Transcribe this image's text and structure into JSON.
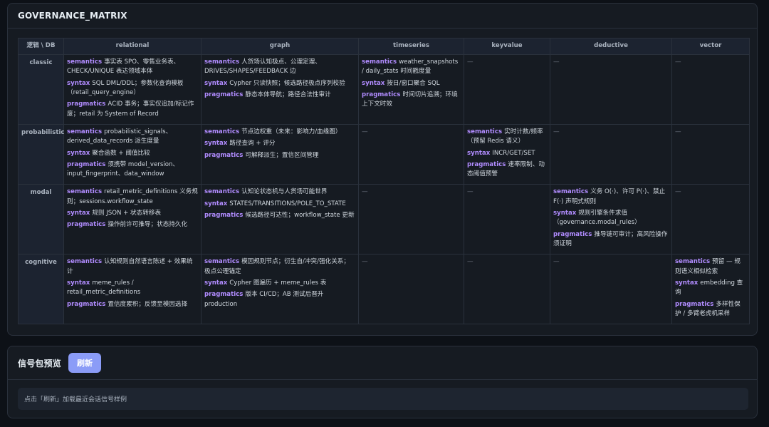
{
  "matrix": {
    "title": "GOVERNANCE_MATRIX",
    "corner_header": "逻辑 \\ DB",
    "columns": [
      "relational",
      "graph",
      "timeseries",
      "keyvalue",
      "deductive",
      "vector"
    ],
    "rows": [
      {
        "label": "classic",
        "cells": [
          [
            {
              "k": "semantics",
              "t": "事实表 SPO、零售业务表、CHECK/UNIQUE 表达领域本体"
            },
            {
              "k": "syntax",
              "t": "SQL DML/DDL；参数化查询模板（retail_query_engine）"
            },
            {
              "k": "pragmatics",
              "t": "ACID 事务；事实仅追加/标记作废；retail 为 System of Record"
            }
          ],
          [
            {
              "k": "semantics",
              "t": "人货场认知极点、公理定理、DRIVES/SHAPES/FEEDBACK 边"
            },
            {
              "k": "syntax",
              "t": "Cypher 只读快照；候选路径极点序列校验"
            },
            {
              "k": "pragmatics",
              "t": "静态本体导航；路径合法性审计"
            }
          ],
          [
            {
              "k": "semantics",
              "t": "weather_snapshots / daily_stats 时间戳度量"
            },
            {
              "k": "syntax",
              "t": "按日/窗口聚合 SQL"
            },
            {
              "k": "pragmatics",
              "t": "时间切片追溯；环境上下文时效"
            }
          ],
          "—",
          "—",
          "—"
        ]
      },
      {
        "label": "probabilistic",
        "cells": [
          [
            {
              "k": "semantics",
              "t": "probabilistic_signals、derived_data_records 派生度量"
            },
            {
              "k": "syntax",
              "t": "聚合函数 + 阈值比较"
            },
            {
              "k": "pragmatics",
              "t": "须携带 model_version、input_fingerprint、data_window"
            }
          ],
          [
            {
              "k": "semantics",
              "t": "节点边权重（未来：影响力/血缘图）"
            },
            {
              "k": "syntax",
              "t": "路径查询 + 评分"
            },
            {
              "k": "pragmatics",
              "t": "可解释派生；置信区间管理"
            }
          ],
          "—",
          [
            {
              "k": "semantics",
              "t": "实时计数/频率（预留 Redis 语义）"
            },
            {
              "k": "syntax",
              "t": "INCR/GET/SET"
            },
            {
              "k": "pragmatics",
              "t": "速率限制、动态阈值预警"
            }
          ],
          "—",
          "—"
        ]
      },
      {
        "label": "modal",
        "cells": [
          [
            {
              "k": "semantics",
              "t": "retail_metric_definitions 义务规则；sessions.workflow_state"
            },
            {
              "k": "syntax",
              "t": "规则 JSON + 状态转移表"
            },
            {
              "k": "pragmatics",
              "t": "操作前许可推导；状态持久化"
            }
          ],
          [
            {
              "k": "semantics",
              "t": "认知论状态机与人货场可能世界"
            },
            {
              "k": "syntax",
              "t": "STATES/TRANSITIONS/POLE_TO_STATE"
            },
            {
              "k": "pragmatics",
              "t": "候选路径可达性；workflow_state 更新"
            }
          ],
          "—",
          "—",
          [
            {
              "k": "semantics",
              "t": "义务 O(·)、许可 P(·)、禁止 F(·) 声明式规则"
            },
            {
              "k": "syntax",
              "t": "规则引擎条件求值（governance.modal_rules）"
            },
            {
              "k": "pragmatics",
              "t": "推导链可审计；高风险操作须证明"
            }
          ],
          "—"
        ]
      },
      {
        "label": "cognitive",
        "cells": [
          [
            {
              "k": "semantics",
              "t": "认知规则自然语言陈述 + 效果统计"
            },
            {
              "k": "syntax",
              "t": "meme_rules / retail_metric_definitions"
            },
            {
              "k": "pragmatics",
              "t": "置信度累积；反馈至模因选择"
            }
          ],
          [
            {
              "k": "semantics",
              "t": "模因规则节点；衍生自/冲突/强化关系；极点公理锚定"
            },
            {
              "k": "syntax",
              "t": "Cypher 图遍历 + meme_rules 表"
            },
            {
              "k": "pragmatics",
              "t": "版本 CI/CD；AB 测试后晋升 production"
            }
          ],
          "—",
          "—",
          "—",
          [
            {
              "k": "semantics",
              "t": "预留 — 规则语义相似检索"
            },
            {
              "k": "syntax",
              "t": "embedding 查询"
            },
            {
              "k": "pragmatics",
              "t": "多样性保护 / 多臂老虎机采样"
            }
          ]
        ]
      }
    ]
  },
  "preview": {
    "title": "信号包预览",
    "refresh_label": "刷新",
    "hint": "点击「刷新」加载最近会话信号样例"
  },
  "colors": {
    "background": "#0d1117",
    "panel": "#161b22",
    "keyword": "#b18cff",
    "button": "#8b9cf7"
  }
}
